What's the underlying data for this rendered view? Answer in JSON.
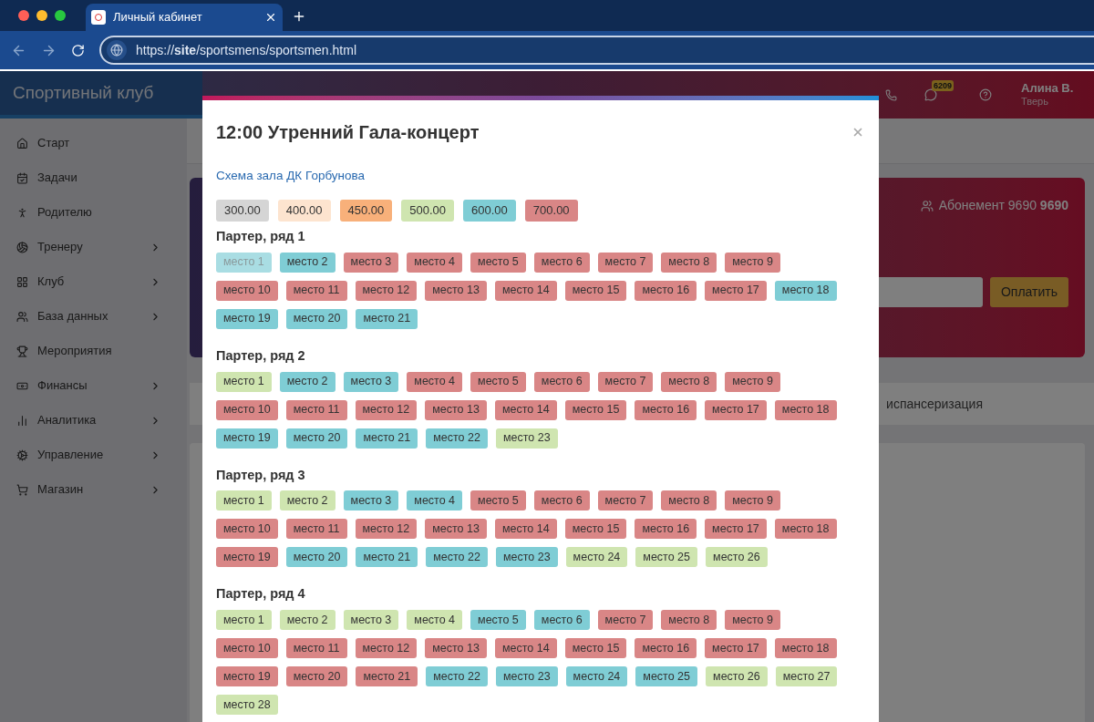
{
  "browser": {
    "tab_title": "Личный кабинет",
    "url": "https://**site**/sportsmens/sportsmen.html"
  },
  "header": {
    "brand": "Спортивный клуб",
    "badge": "6209",
    "user_name": "Алина В.",
    "user_city": "Тверь"
  },
  "sidebar": {
    "items": [
      {
        "label": "Старт",
        "has_submenu": false
      },
      {
        "label": "Задачи",
        "has_submenu": false
      },
      {
        "label": "Родителю",
        "has_submenu": false
      },
      {
        "label": "Тренеру",
        "has_submenu": true
      },
      {
        "label": "Клуб",
        "has_submenu": true
      },
      {
        "label": "База данных",
        "has_submenu": true
      },
      {
        "label": "Мероприятия",
        "has_submenu": false
      },
      {
        "label": "Финансы",
        "has_submenu": true
      },
      {
        "label": "Аналитика",
        "has_submenu": true
      },
      {
        "label": "Управление",
        "has_submenu": true
      },
      {
        "label": "Магазин",
        "has_submenu": true
      }
    ]
  },
  "card": {
    "subscription": "Абонемент 9690 **9690**",
    "pay_button": "Оплатить"
  },
  "tabs": [
    {
      "label": "испансеризация"
    }
  ],
  "modal": {
    "title": "12:00 Утренний Гала-концерт",
    "link": "Схема зала ДК Горбунова",
    "prices": [
      {
        "label": "300.00",
        "color": "#d5d5d5"
      },
      {
        "label": "400.00",
        "color": "#fde4cf"
      },
      {
        "label": "450.00",
        "color": "#f8b07a"
      },
      {
        "label": "500.00",
        "color": "#cfe5b0"
      },
      {
        "label": "600.00",
        "color": "#7fcdd5"
      },
      {
        "label": "700.00",
        "color": "#d98686"
      }
    ],
    "rows": [
      {
        "title": "Партер, ряд 1",
        "seats": [
          {
            "label": "место 1",
            "color": "#a9dde3",
            "disabled": true
          },
          {
            "label": "место 2",
            "color": "#7fcdd5",
            "disabled": false
          },
          {
            "label": "место 3",
            "color": "#d98686",
            "disabled": false
          },
          {
            "label": "место 4",
            "color": "#d98686",
            "disabled": false
          },
          {
            "label": "место 5",
            "color": "#d98686",
            "disabled": false
          },
          {
            "label": "место 6",
            "color": "#d98686",
            "disabled": false
          },
          {
            "label": "место 7",
            "color": "#d98686",
            "disabled": false
          },
          {
            "label": "место 8",
            "color": "#d98686",
            "disabled": false
          },
          {
            "label": "место 9",
            "color": "#d98686",
            "disabled": false
          },
          {
            "label": "место 10",
            "color": "#d98686",
            "disabled": false
          },
          {
            "label": "место 11",
            "color": "#d98686",
            "disabled": false
          },
          {
            "label": "место 12",
            "color": "#d98686",
            "disabled": false
          },
          {
            "label": "место 13",
            "color": "#d98686",
            "disabled": false
          },
          {
            "label": "место 14",
            "color": "#d98686",
            "disabled": false
          },
          {
            "label": "место 15",
            "color": "#d98686",
            "disabled": false
          },
          {
            "label": "место 16",
            "color": "#d98686",
            "disabled": false
          },
          {
            "label": "место 17",
            "color": "#d98686",
            "disabled": false
          },
          {
            "label": "место 18",
            "color": "#7fcdd5",
            "disabled": false
          },
          {
            "label": "место 19",
            "color": "#7fcdd5",
            "disabled": false
          },
          {
            "label": "место 20",
            "color": "#7fcdd5",
            "disabled": false
          },
          {
            "label": "место 21",
            "color": "#7fcdd5",
            "disabled": false
          }
        ]
      },
      {
        "title": "Партер, ряд 2",
        "seats": [
          {
            "label": "место 1",
            "color": "#cfe5b0",
            "disabled": false
          },
          {
            "label": "место 2",
            "color": "#7fcdd5",
            "disabled": false
          },
          {
            "label": "место 3",
            "color": "#7fcdd5",
            "disabled": false
          },
          {
            "label": "место 4",
            "color": "#d98686",
            "disabled": false
          },
          {
            "label": "место 5",
            "color": "#d98686",
            "disabled": false
          },
          {
            "label": "место 6",
            "color": "#d98686",
            "disabled": false
          },
          {
            "label": "место 7",
            "color": "#d98686",
            "disabled": false
          },
          {
            "label": "место 8",
            "color": "#d98686",
            "disabled": false
          },
          {
            "label": "место 9",
            "color": "#d98686",
            "disabled": false
          },
          {
            "label": "место 10",
            "color": "#d98686",
            "disabled": false
          },
          {
            "label": "место 11",
            "color": "#d98686",
            "disabled": false
          },
          {
            "label": "место 12",
            "color": "#d98686",
            "disabled": false
          },
          {
            "label": "место 13",
            "color": "#d98686",
            "disabled": false
          },
          {
            "label": "место 14",
            "color": "#d98686",
            "disabled": false
          },
          {
            "label": "место 15",
            "color": "#d98686",
            "disabled": false
          },
          {
            "label": "место 16",
            "color": "#d98686",
            "disabled": false
          },
          {
            "label": "место 17",
            "color": "#d98686",
            "disabled": false
          },
          {
            "label": "место 18",
            "color": "#d98686",
            "disabled": false
          },
          {
            "label": "место 19",
            "color": "#7fcdd5",
            "disabled": false
          },
          {
            "label": "место 20",
            "color": "#7fcdd5",
            "disabled": false
          },
          {
            "label": "место 21",
            "color": "#7fcdd5",
            "disabled": false
          },
          {
            "label": "место 22",
            "color": "#7fcdd5",
            "disabled": false
          },
          {
            "label": "место 23",
            "color": "#cfe5b0",
            "disabled": false
          }
        ]
      },
      {
        "title": "Партер, ряд 3",
        "seats": [
          {
            "label": "место 1",
            "color": "#cfe5b0",
            "disabled": false
          },
          {
            "label": "место 2",
            "color": "#cfe5b0",
            "disabled": false
          },
          {
            "label": "место 3",
            "color": "#7fcdd5",
            "disabled": false
          },
          {
            "label": "место 4",
            "color": "#7fcdd5",
            "disabled": false
          },
          {
            "label": "место 5",
            "color": "#d98686",
            "disabled": false
          },
          {
            "label": "место 6",
            "color": "#d98686",
            "disabled": false
          },
          {
            "label": "место 7",
            "color": "#d98686",
            "disabled": false
          },
          {
            "label": "место 8",
            "color": "#d98686",
            "disabled": false
          },
          {
            "label": "место 9",
            "color": "#d98686",
            "disabled": false
          },
          {
            "label": "место 10",
            "color": "#d98686",
            "disabled": false
          },
          {
            "label": "место 11",
            "color": "#d98686",
            "disabled": false
          },
          {
            "label": "место 12",
            "color": "#d98686",
            "disabled": false
          },
          {
            "label": "место 13",
            "color": "#d98686",
            "disabled": false
          },
          {
            "label": "место 14",
            "color": "#d98686",
            "disabled": false
          },
          {
            "label": "место 15",
            "color": "#d98686",
            "disabled": false
          },
          {
            "label": "место 16",
            "color": "#d98686",
            "disabled": false
          },
          {
            "label": "место 17",
            "color": "#d98686",
            "disabled": false
          },
          {
            "label": "место 18",
            "color": "#d98686",
            "disabled": false
          },
          {
            "label": "место 19",
            "color": "#d98686",
            "disabled": false
          },
          {
            "label": "место 20",
            "color": "#7fcdd5",
            "disabled": false
          },
          {
            "label": "место 21",
            "color": "#7fcdd5",
            "disabled": false
          },
          {
            "label": "место 22",
            "color": "#7fcdd5",
            "disabled": false
          },
          {
            "label": "место 23",
            "color": "#7fcdd5",
            "disabled": false
          },
          {
            "label": "место 24",
            "color": "#cfe5b0",
            "disabled": false
          },
          {
            "label": "место 25",
            "color": "#cfe5b0",
            "disabled": false
          },
          {
            "label": "место 26",
            "color": "#cfe5b0",
            "disabled": false
          }
        ]
      },
      {
        "title": "Партер, ряд 4",
        "seats": [
          {
            "label": "место 1",
            "color": "#cfe5b0",
            "disabled": false
          },
          {
            "label": "место 2",
            "color": "#cfe5b0",
            "disabled": false
          },
          {
            "label": "место 3",
            "color": "#cfe5b0",
            "disabled": false
          },
          {
            "label": "место 4",
            "color": "#cfe5b0",
            "disabled": false
          },
          {
            "label": "место 5",
            "color": "#7fcdd5",
            "disabled": false
          },
          {
            "label": "место 6",
            "color": "#7fcdd5",
            "disabled": false
          },
          {
            "label": "место 7",
            "color": "#d98686",
            "disabled": false
          },
          {
            "label": "место 8",
            "color": "#d98686",
            "disabled": false
          },
          {
            "label": "место 9",
            "color": "#d98686",
            "disabled": false
          },
          {
            "label": "место 10",
            "color": "#d98686",
            "disabled": false
          },
          {
            "label": "место 11",
            "color": "#d98686",
            "disabled": false
          },
          {
            "label": "место 12",
            "color": "#d98686",
            "disabled": false
          },
          {
            "label": "место 13",
            "color": "#d98686",
            "disabled": false
          },
          {
            "label": "место 14",
            "color": "#d98686",
            "disabled": false
          },
          {
            "label": "место 15",
            "color": "#d98686",
            "disabled": false
          },
          {
            "label": "место 16",
            "color": "#d98686",
            "disabled": false
          },
          {
            "label": "место 17",
            "color": "#d98686",
            "disabled": false
          },
          {
            "label": "место 18",
            "color": "#d98686",
            "disabled": false
          },
          {
            "label": "место 19",
            "color": "#d98686",
            "disabled": false
          },
          {
            "label": "место 20",
            "color": "#d98686",
            "disabled": false
          },
          {
            "label": "место 21",
            "color": "#d98686",
            "disabled": false
          },
          {
            "label": "место 22",
            "color": "#7fcdd5",
            "disabled": false
          },
          {
            "label": "место 23",
            "color": "#7fcdd5",
            "disabled": false
          },
          {
            "label": "место 24",
            "color": "#7fcdd5",
            "disabled": false
          },
          {
            "label": "место 25",
            "color": "#7fcdd5",
            "disabled": false
          },
          {
            "label": "место 26",
            "color": "#cfe5b0",
            "disabled": false
          },
          {
            "label": "место 27",
            "color": "#cfe5b0",
            "disabled": false
          },
          {
            "label": "место 28",
            "color": "#cfe5b0",
            "disabled": false
          }
        ]
      }
    ]
  }
}
